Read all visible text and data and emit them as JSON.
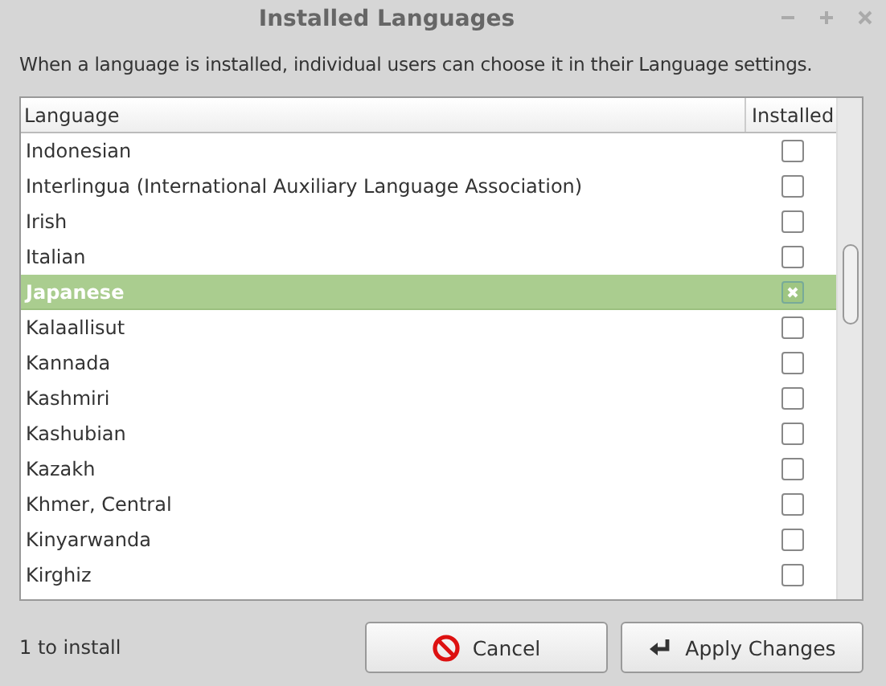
{
  "window": {
    "title": "Installed Languages"
  },
  "description": "When a language is installed, individual users can choose it in their Language settings.",
  "table": {
    "columns": [
      "Language",
      "Installed"
    ],
    "rows": [
      {
        "name": "Indonesian",
        "checked": false,
        "selected": false
      },
      {
        "name": "Interlingua (International Auxiliary Language Association)",
        "checked": false,
        "selected": false
      },
      {
        "name": "Irish",
        "checked": false,
        "selected": false
      },
      {
        "name": "Italian",
        "checked": false,
        "selected": false
      },
      {
        "name": "Japanese",
        "checked": true,
        "selected": true
      },
      {
        "name": "Kalaallisut",
        "checked": false,
        "selected": false
      },
      {
        "name": "Kannada",
        "checked": false,
        "selected": false
      },
      {
        "name": "Kashmiri",
        "checked": false,
        "selected": false
      },
      {
        "name": "Kashubian",
        "checked": false,
        "selected": false
      },
      {
        "name": "Kazakh",
        "checked": false,
        "selected": false
      },
      {
        "name": "Khmer, Central",
        "checked": false,
        "selected": false
      },
      {
        "name": "Kinyarwanda",
        "checked": false,
        "selected": false
      },
      {
        "name": "Kirghiz",
        "checked": false,
        "selected": false
      }
    ]
  },
  "status": "1 to install",
  "buttons": [
    {
      "kind": "cancel",
      "label": "Cancel"
    },
    {
      "kind": "apply",
      "label": "Apply Changes"
    }
  ]
}
